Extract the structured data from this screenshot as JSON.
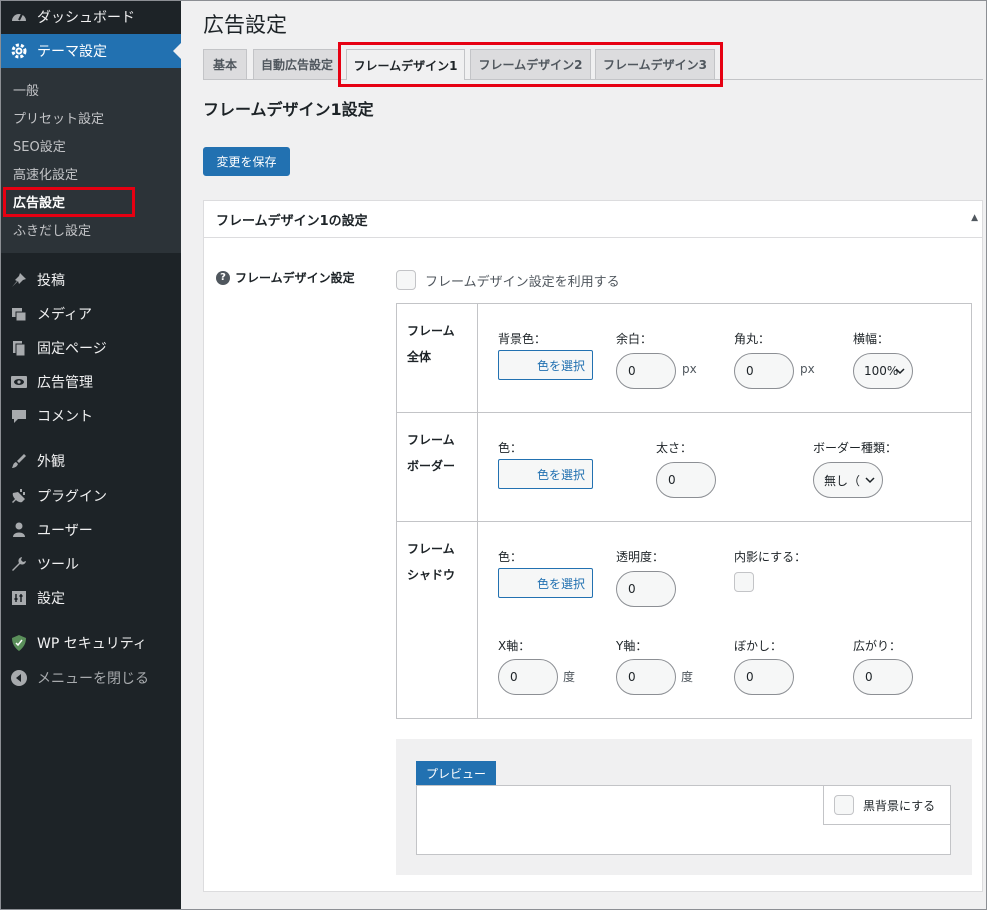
{
  "sidebar": {
    "items": [
      {
        "label": "ダッシュボード",
        "icon": "dashboard-icon"
      },
      {
        "label": "テーマ設定",
        "icon": "gear-icon",
        "active": true
      },
      {
        "label": "投稿",
        "icon": "pin-icon"
      },
      {
        "label": "メディア",
        "icon": "media-icon"
      },
      {
        "label": "固定ページ",
        "icon": "page-icon"
      },
      {
        "label": "広告管理",
        "icon": "eye-icon"
      },
      {
        "label": "コメント",
        "icon": "comment-icon"
      },
      {
        "label": "外観",
        "icon": "brush-icon"
      },
      {
        "label": "プラグイン",
        "icon": "plugin-icon"
      },
      {
        "label": "ユーザー",
        "icon": "user-icon"
      },
      {
        "label": "ツール",
        "icon": "wrench-icon"
      },
      {
        "label": "設定",
        "icon": "settings-icon"
      },
      {
        "label": "WP セキュリティ",
        "icon": "shield-icon"
      },
      {
        "label": "メニューを閉じる",
        "icon": "collapse-icon"
      }
    ],
    "submenu": [
      "一般",
      "プリセット設定",
      "SEO設定",
      "高速化設定",
      "広告設定",
      "ふきだし設定"
    ]
  },
  "page_title": "広告設定",
  "tabs": [
    "基本",
    "自動広告設定",
    "フレームデザイン1",
    "フレームデザイン2",
    "フレームデザイン3"
  ],
  "active_tab": "フレームデザイン1",
  "section_title": "フレームデザイン1設定",
  "save_button": "変更を保存",
  "panel": {
    "title": "フレームデザイン1の設定",
    "field_label": "フレームデザイン設定",
    "use_checkbox": "フレームデザイン設定を利用する",
    "rows": {
      "whole": {
        "head1": "フレーム",
        "head2": "全体",
        "bg_label": "背景色：",
        "color_btn": "色を選択",
        "margin_label": "余白：",
        "margin_value": "0",
        "margin_unit": "px",
        "radius_label": "角丸：",
        "radius_value": "0",
        "radius_unit": "px",
        "width_label": "横幅：",
        "width_value": "100%"
      },
      "border": {
        "head1": "フレーム",
        "head2": "ボーダー",
        "color_label": "色：",
        "color_btn": "色を選択",
        "thick_label": "太さ：",
        "thick_value": "0",
        "type_label": "ボーダー種類：",
        "type_value": "無し（"
      },
      "shadow": {
        "head1": "フレーム",
        "head2": "シャドウ",
        "color_label": "色：",
        "color_btn": "色を選択",
        "opacity_label": "透明度：",
        "opacity_value": "0",
        "inner_label": "内影にする：",
        "x_label": "X軸：",
        "x_value": "0",
        "x_unit": "度",
        "y_label": "Y軸：",
        "y_value": "0",
        "y_unit": "度",
        "blur_label": "ぼかし：",
        "blur_value": "0",
        "spread_label": "広がり：",
        "spread_value": "0"
      }
    }
  },
  "preview": {
    "tab": "プレビュー",
    "dark_bg": "黒背景にする"
  },
  "colors": {
    "sidebar_bg": "#1d2327",
    "accent": "#2271b1",
    "highlight": "#e60012"
  }
}
